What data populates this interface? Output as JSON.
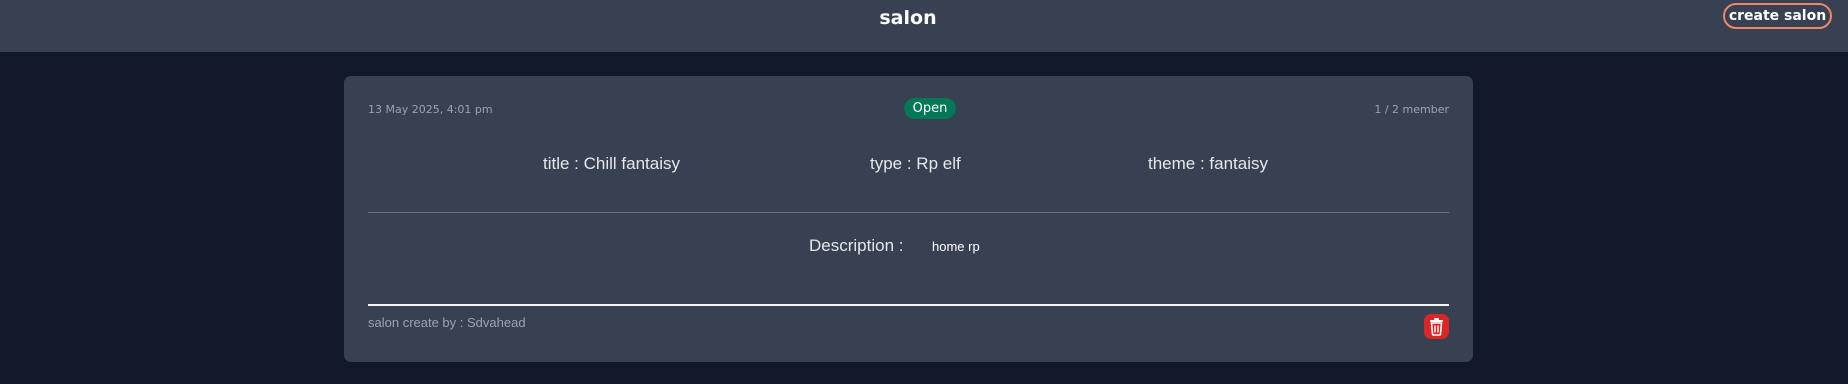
{
  "header": {
    "title": "salon",
    "create_button_label": "create salon"
  },
  "salon_card": {
    "date": "13 May 2025, 4:01 pm",
    "status": "Open",
    "members": "1 / 2 member",
    "title_text": "title : Chill fantaisy",
    "type_text": "type : Rp elf",
    "theme_text": "theme : fantaisy",
    "description_label": "Description :",
    "description_value": "home rp",
    "creator_text": "salon create by : Sdvahead",
    "delete_icon": "trash-icon"
  },
  "colors": {
    "page_bg": "#111827",
    "panel_bg": "#374151",
    "accent_border": "#f0866b",
    "status_green": "#047857",
    "delete_red": "#dc2626"
  }
}
